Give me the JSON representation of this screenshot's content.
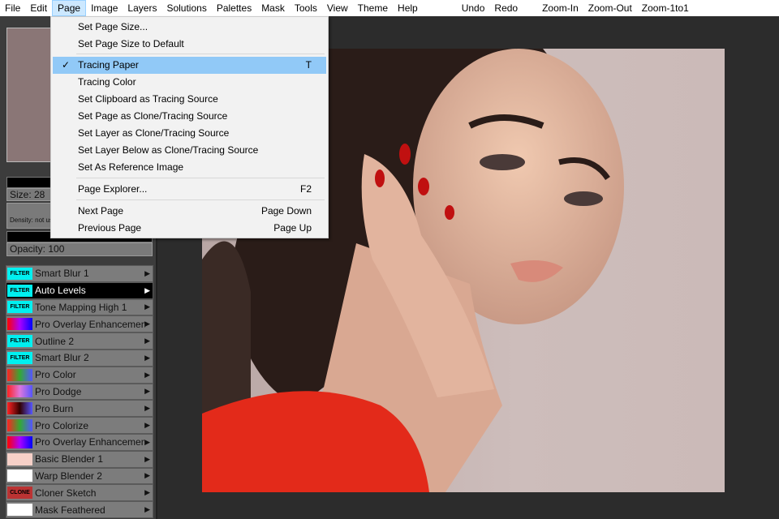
{
  "menubar": [
    "File",
    "Edit",
    "Page",
    "Image",
    "Layers",
    "Solutions",
    "Palettes",
    "Mask",
    "Tools",
    "View",
    "Theme",
    "Help"
  ],
  "toolbar": [
    "Undo",
    "Redo",
    "Zoom-In",
    "Zoom-Out",
    "Zoom-1to1"
  ],
  "left_panel": {
    "size_label": "Size: 28",
    "density_label": "Density: not used",
    "opacity_label": "Opacity: 100",
    "swatch_color": "#8a7676"
  },
  "brushes": [
    {
      "label": "Smart Blur 1",
      "thumb": "FILTER"
    },
    {
      "label": "Auto Levels",
      "thumb": "FILTER",
      "selected": true
    },
    {
      "label": "Tone Mapping High 1",
      "thumb": "FILTER"
    },
    {
      "label": "Pro Overlay Enhancement",
      "thumb": ""
    },
    {
      "label": "Outline 2",
      "thumb": "FILTER"
    },
    {
      "label": "Smart Blur 2",
      "thumb": "FILTER"
    },
    {
      "label": "Pro Color",
      "thumb": ""
    },
    {
      "label": "Pro Dodge",
      "thumb": ""
    },
    {
      "label": "Pro Burn",
      "thumb": ""
    },
    {
      "label": "Pro Colorize",
      "thumb": ""
    },
    {
      "label": "Pro Overlay Enhancement",
      "thumb": ""
    },
    {
      "label": "Basic Blender 1",
      "thumb": ""
    },
    {
      "label": "Warp Blender 2",
      "thumb": ""
    },
    {
      "label": "Cloner Sketch",
      "thumb": "CLONE"
    },
    {
      "label": "Mask Feathered",
      "thumb": ""
    }
  ],
  "page_menu": {
    "items": [
      {
        "label": "Set Page Size..."
      },
      {
        "label": "Set Page Size to Default"
      },
      {
        "label": "Tracing Paper",
        "shortcut": "T",
        "checked": "✓"
      },
      {
        "label": "Tracing Color"
      },
      {
        "label": "Set Clipboard as Tracing Source"
      },
      {
        "label": "Set Page as Clone/Tracing Source"
      },
      {
        "label": "Set Layer as Clone/Tracing Source"
      },
      {
        "label": "Set Layer Below as Clone/Tracing Source"
      },
      {
        "label": "Set As Reference Image"
      },
      {
        "label": "Page Explorer...",
        "shortcut": "F2"
      },
      {
        "label": "Next Page",
        "shortcut": "Page Down"
      },
      {
        "label": "Previous Page",
        "shortcut": "Page Up"
      }
    ]
  }
}
